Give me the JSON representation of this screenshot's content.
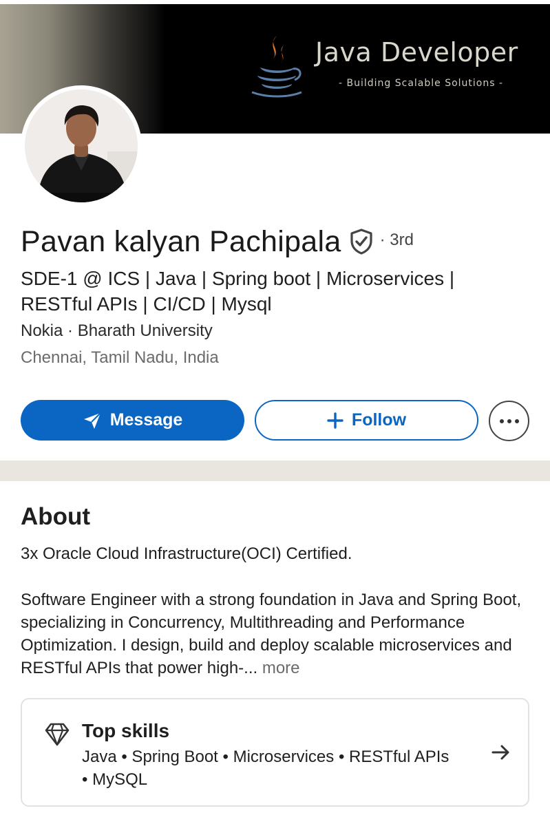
{
  "banner": {
    "title": "Java Developer",
    "subtitle": "- Building Scalable Solutions -",
    "logo_icon": "java-coffee-cup-icon"
  },
  "profile": {
    "name": "Pavan kalyan Pachipala",
    "verified_icon": "verified-shield-icon",
    "degree": "· 3rd",
    "headline": "SDE-1 @ ICS | Java | Spring boot | Microservices | RESTful APIs | CI/CD | Mysql",
    "company_school": "Nokia · Bharath University",
    "location": "Chennai, Tamil Nadu, India"
  },
  "actions": {
    "message_label": "Message",
    "message_icon": "send-icon",
    "follow_label": "Follow",
    "follow_icon": "plus-icon",
    "more_icon": "more-icon"
  },
  "about": {
    "title": "About",
    "line1": "3x Oracle Cloud Infrastructure(OCI) Certified.",
    "body": "Software Engineer with a strong foundation in Java and Spring Boot, specializing in Concurrency, Multithreading and Performance Optimization. I design, build and deploy scalable microservices and RESTful APIs that power high-...",
    "more_label": "more"
  },
  "top_skills": {
    "title": "Top skills",
    "skills": "Java • Spring Boot • Microservices • RESTful APIs • MySQL",
    "icon": "diamond-icon",
    "arrow_icon": "arrow-right-icon"
  },
  "colors": {
    "accent": "#0a66c2",
    "divider": "#e9e5df",
    "muted_text": "#6b6b6b"
  }
}
